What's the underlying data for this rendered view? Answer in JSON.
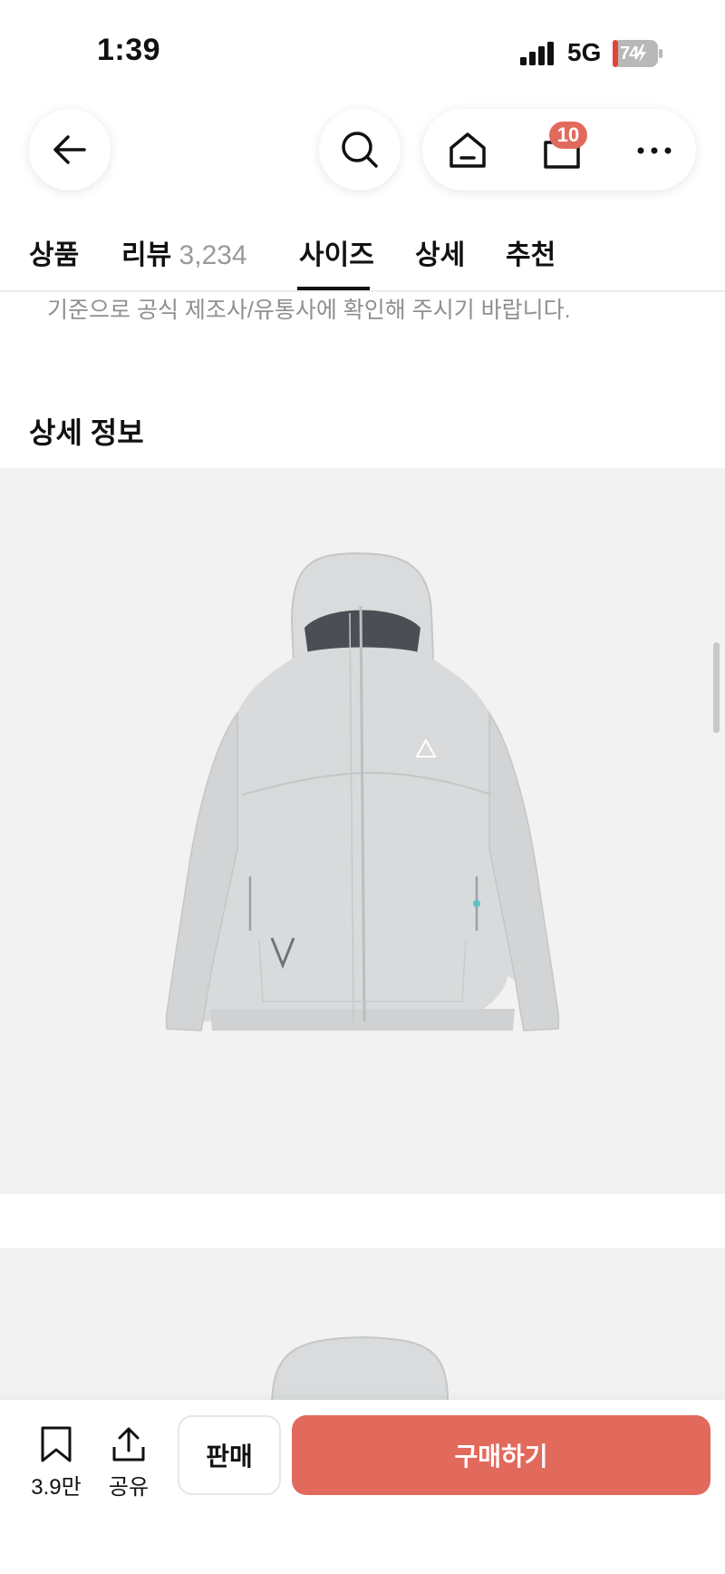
{
  "status_bar": {
    "time": "1:39",
    "network": "5G",
    "battery": "74"
  },
  "nav": {
    "cart_count": "10",
    "icons": [
      "back-arrow-icon",
      "search-icon",
      "home-icon",
      "shopping-bag-icon",
      "more-icon"
    ]
  },
  "tabs": [
    {
      "label": "상품"
    },
    {
      "label": "리뷰",
      "count": "3,234"
    },
    {
      "label": "사이즈",
      "active": true
    },
    {
      "label": "상세"
    },
    {
      "label": "추천"
    }
  ],
  "content": {
    "notice": "기준으로 공식 제조사/유통사에 확인해 주시기 바랍니다.",
    "section_title": "상세 정보"
  },
  "bottom_bar": {
    "bookmark_count": "3.9만",
    "share_label": "공유",
    "sell_label": "판매",
    "buy_label": "구매하기"
  },
  "colors": {
    "accent": "#e16a5c",
    "image_bg": "#f2f2f2",
    "jacket": "#d6d8d9"
  }
}
